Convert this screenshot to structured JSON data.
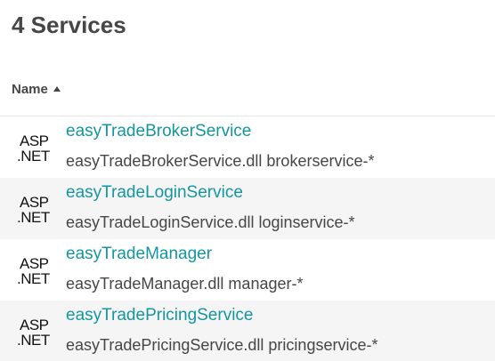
{
  "header": {
    "title": "4 Services"
  },
  "table": {
    "column_name": "Name",
    "sort_direction": "ascending",
    "rows": [
      {
        "icon": "aspnet-icon",
        "icon_text_line1": "ASP",
        "icon_text_line2": ".NET",
        "name": "easyTradeBrokerService",
        "detail": "easyTradeBrokerService.dll brokerservice-*"
      },
      {
        "icon": "aspnet-icon",
        "icon_text_line1": "ASP",
        "icon_text_line2": ".NET",
        "name": "easyTradeLoginService",
        "detail": "easyTradeLoginService.dll loginservice-*"
      },
      {
        "icon": "aspnet-icon",
        "icon_text_line1": "ASP",
        "icon_text_line2": ".NET",
        "name": "easyTradeManager",
        "detail": "easyTradeManager.dll manager-*"
      },
      {
        "icon": "aspnet-icon",
        "icon_text_line1": "ASP",
        "icon_text_line2": ".NET",
        "name": "easyTradePricingService",
        "detail": "easyTradePricingService.dll pricingservice-*"
      }
    ]
  },
  "colors": {
    "link": "#1496a1",
    "text": "#454646",
    "alt_row": "#f5f5f5",
    "divider": "#e6e6e6"
  }
}
